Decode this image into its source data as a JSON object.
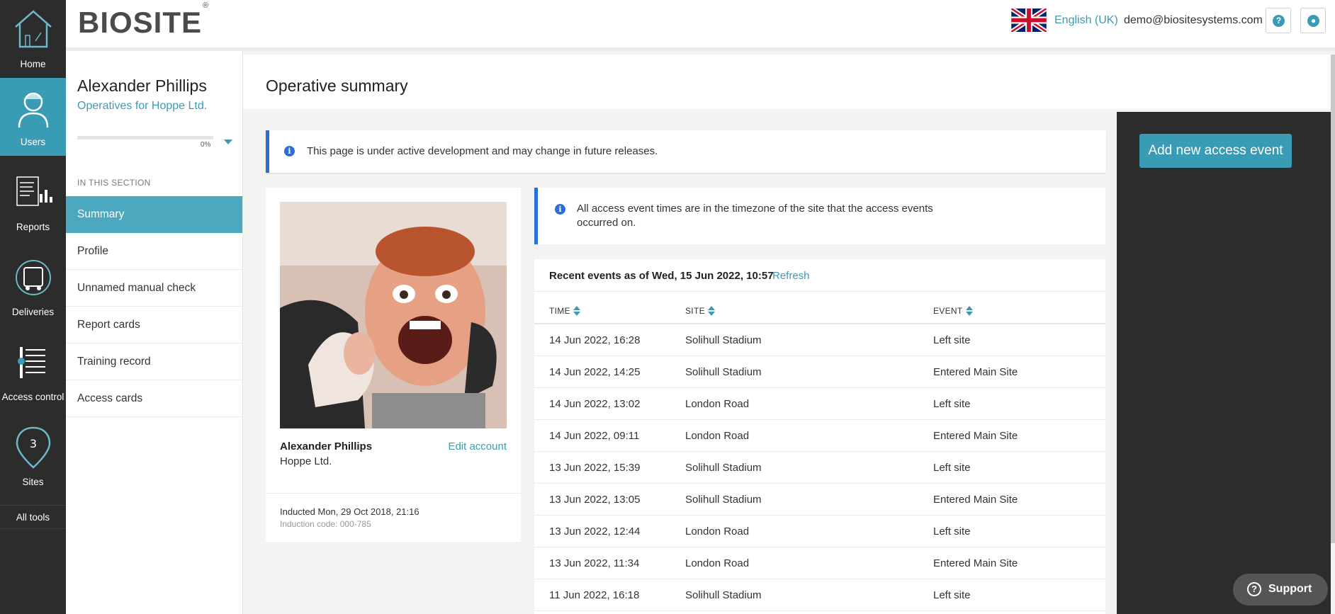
{
  "rail": {
    "items": [
      {
        "label": "Home",
        "icon": "home-icon"
      },
      {
        "label": "Users",
        "icon": "user-icon"
      },
      {
        "label": "Reports",
        "icon": "reports-icon"
      },
      {
        "label": "Deliveries",
        "icon": "truck-icon"
      },
      {
        "label": "Access control",
        "icon": "access-control-icon"
      },
      {
        "label": "Sites",
        "icon": "map-pin-icon"
      }
    ],
    "all_tools": "All tools"
  },
  "header": {
    "logo": "BIOSITE",
    "logo_mark": "®",
    "language": "English (UK)",
    "email": "demo@biositesystems.com",
    "help_glyph": "?",
    "account_glyph": "●"
  },
  "section": {
    "person_name": "Alexander Phillips",
    "subtitle": "Operatives for Hoppe Ltd.",
    "progress_percent": "0%",
    "heading": "IN THIS SECTION",
    "items": [
      "Summary",
      "Profile",
      "Unnamed manual check",
      "Report cards",
      "Training record",
      "Access cards"
    ]
  },
  "main": {
    "title": "Operative summary",
    "notice": "This page is under active development and may change in future releases.",
    "tz_note": "All access event times are in the timezone of the site that the access events occurred on.",
    "info_glyph": "i"
  },
  "profile": {
    "name": "Alexander Phillips",
    "company": "Hoppe Ltd.",
    "edit_link": "Edit account",
    "inducted": "Inducted Mon, 29 Oct 2018, 21:16",
    "induction_code": "Induction code: 000-785"
  },
  "events": {
    "heading": "Recent events as of Wed, 15 Jun 2022, 10:57",
    "refresh": "Refresh",
    "columns": [
      "TIME",
      "SITE",
      "EVENT"
    ],
    "rows": [
      [
        "14 Jun 2022, 16:28",
        "Solihull Stadium",
        "Left site"
      ],
      [
        "14 Jun 2022, 14:25",
        "Solihull Stadium",
        "Entered Main Site"
      ],
      [
        "14 Jun 2022, 13:02",
        "London Road",
        "Left site"
      ],
      [
        "14 Jun 2022, 09:11",
        "London Road",
        "Entered Main Site"
      ],
      [
        "13 Jun 2022, 15:39",
        "Solihull Stadium",
        "Left site"
      ],
      [
        "13 Jun 2022, 13:05",
        "Solihull Stadium",
        "Entered Main Site"
      ],
      [
        "13 Jun 2022, 12:44",
        "London Road",
        "Left site"
      ],
      [
        "13 Jun 2022, 11:34",
        "London Road",
        "Entered Main Site"
      ],
      [
        "11 Jun 2022, 16:18",
        "Solihull Stadium",
        "Left site"
      ]
    ]
  },
  "actions": {
    "add_event": "Add new access event"
  },
  "support": {
    "label": "Support",
    "glyph": "?"
  },
  "colors": {
    "accent": "#3a9bb4",
    "rail": "#2c2c2c",
    "info": "#2b6fd6"
  }
}
